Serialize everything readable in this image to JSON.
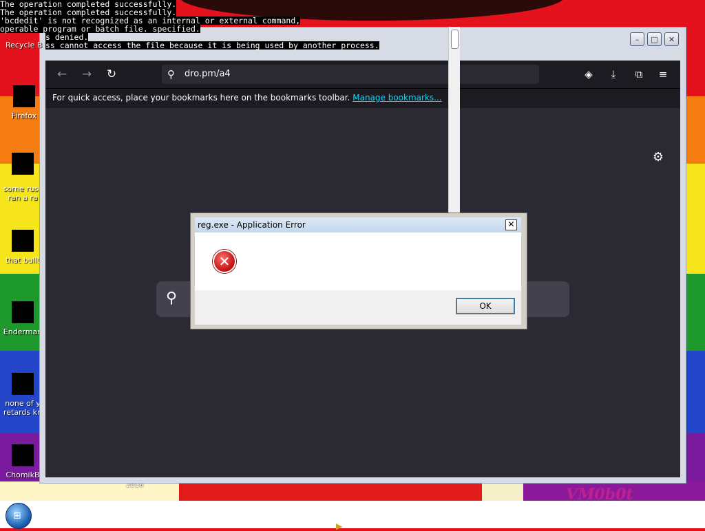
{
  "console": {
    "lines": [
      "The operation completed successfully.",
      "The operation completed successfully.",
      "'bcdedit' is not recognized as an internal or external command,",
      "operable program or batch file. specified."
    ],
    "denied": "s denied.",
    "tail": "ss cannot access the file because it is being used by another process."
  },
  "desktop": {
    "recycle_label": "Recycle B",
    "icons": [
      {
        "label": "Firefox"
      },
      {
        "label": "some russ",
        "label2": "ran a ra"
      },
      {
        "label": "that bullt"
      },
      {
        "label": "Enderman"
      },
      {
        "label": "none of y",
        "label2": "retards kn"
      },
      {
        "label": "ChomikB"
      }
    ],
    "art_year": "2016",
    "art_signature": "VM0b0t"
  },
  "browser": {
    "url": "dro.pm/a4",
    "bookmarks_text": "For quick access, place your bookmarks here on the bookmarks toolbar.",
    "bookmarks_link": "Manage bookmarks..."
  },
  "dialog": {
    "title": "reg.exe - Application Error",
    "close_label": "✕",
    "ok_label": "OK",
    "icon": "error-icon"
  },
  "colors": {
    "accent_link": "#00ddff",
    "browser_bg": "#2b2a33",
    "error_red": "#c01010"
  }
}
